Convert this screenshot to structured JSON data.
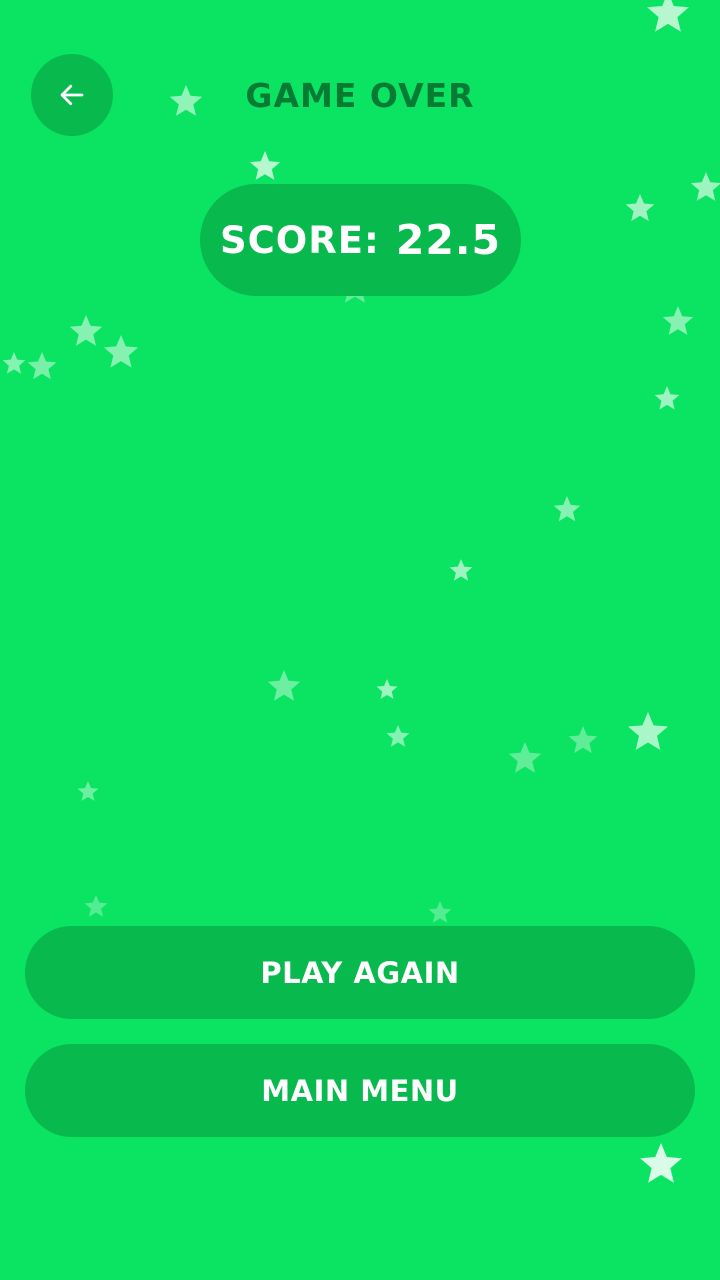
{
  "header": {
    "title": "GAME OVER",
    "back_icon": "arrow-left-icon"
  },
  "score": {
    "label": "SCORE:",
    "value": "22.5"
  },
  "buttons": {
    "play_again": "PLAY AGAIN",
    "main_menu": "MAIN MENU"
  },
  "colors": {
    "background": "#0be462",
    "button": "#08b94e",
    "title": "#077b34",
    "text": "#ffffff"
  }
}
